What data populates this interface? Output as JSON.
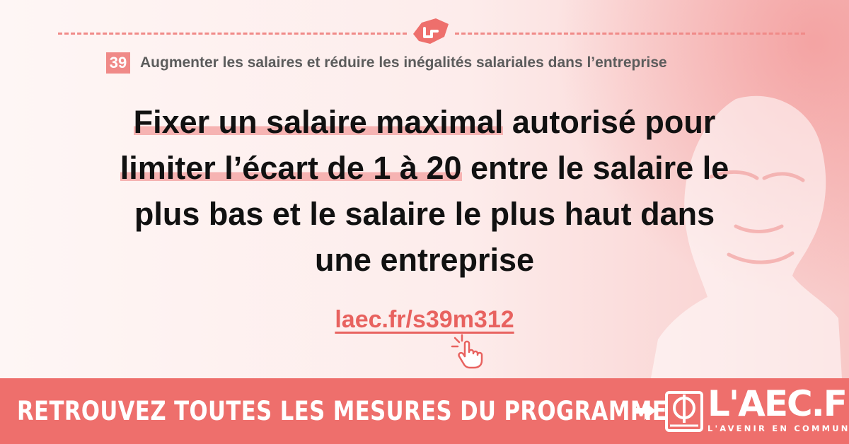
{
  "colors": {
    "accent": "#ee6f6c",
    "highlight": "#f6b3b2",
    "link": "#e8625f",
    "text": "#111111",
    "subtitle": "#5c5c5c"
  },
  "header": {
    "icon": "handshake-icon",
    "measure_number": "39",
    "measure_title": "Augmenter les salaires et réduire les inégalités salariales dans l’entreprise"
  },
  "headline": {
    "line1_highlight": "Fixer un salaire maximal",
    "line1_rest": " autorisé pour",
    "line2_highlight": "limiter l’écart de 1 à 20",
    "line2_rest": " entre le salaire le",
    "line3": "plus bas et le salaire le plus haut dans",
    "line4": "une entreprise"
  },
  "link": {
    "text": "laec.fr/s39m312",
    "icon": "pointer-hand-icon"
  },
  "footer": {
    "cta": "RETROUVEZ TOUTES LES MESURES DU PROGRAMME",
    "arrow_icon": "arrow-right-icon",
    "logo_icon": "phi-book-logo-icon",
    "brand": "L'AEC.FR",
    "tagline": "L'AVENIR EN COMMUN"
  }
}
